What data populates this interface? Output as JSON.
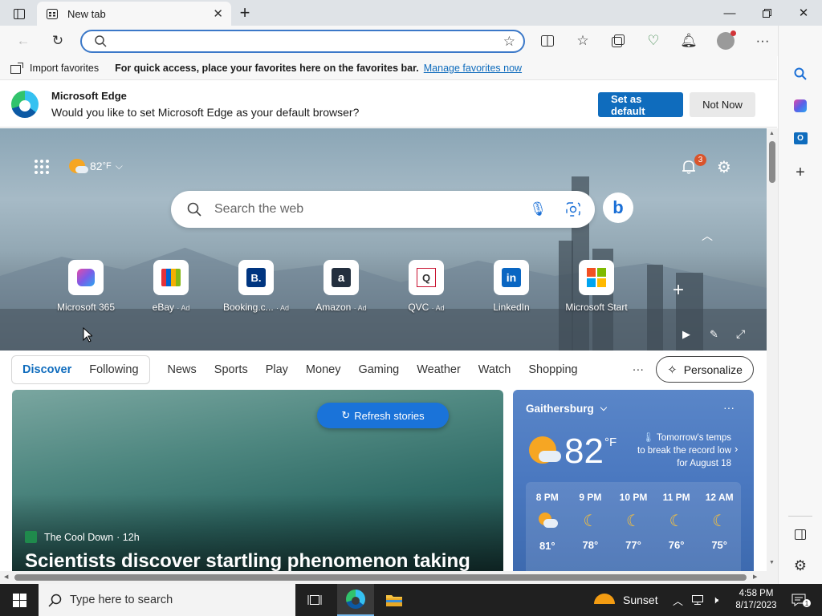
{
  "browser": {
    "tab_title": "New tab",
    "address_value": ""
  },
  "favorites_bar": {
    "import_label": "Import favorites",
    "message": "For quick access, place your favorites here on the favorites bar.",
    "manage_link": "Manage favorites now"
  },
  "infobar": {
    "title": "Microsoft Edge",
    "message": "Would you like to set Microsoft Edge as your default browser?",
    "primary_label": "Set as default",
    "secondary_label": "Not Now"
  },
  "newtab": {
    "weather_temp": "82",
    "weather_unit": "°F",
    "notification_count": "3",
    "search_placeholder": "Search the web",
    "quick_links": [
      {
        "label": "Microsoft 365",
        "ad": ""
      },
      {
        "label": "eBay",
        "ad": "· Ad"
      },
      {
        "label": "Booking.c...",
        "ad": "· Ad"
      },
      {
        "label": "Amazon",
        "ad": "· Ad"
      },
      {
        "label": "QVC",
        "ad": "· Ad"
      },
      {
        "label": "LinkedIn",
        "ad": ""
      },
      {
        "label": "Microsoft Start",
        "ad": ""
      }
    ]
  },
  "feed": {
    "tabs": [
      "Discover",
      "Following"
    ],
    "categories": [
      "News",
      "Sports",
      "Play",
      "Money",
      "Gaming",
      "Weather",
      "Watch",
      "Shopping"
    ],
    "more": "···",
    "personalize": "Personalize",
    "refresh": "Refresh stories",
    "story": {
      "source": "The Cool Down",
      "age": "· 12h",
      "headline": "Scientists discover startling phenomenon taking"
    }
  },
  "weather": {
    "city": "Gaithersburg",
    "temp": "82",
    "unit": "°F",
    "alert_line1": "Tomorrow's temps",
    "alert_line2": "to break the record low",
    "alert_line3": "for August 18",
    "hourly": [
      {
        "time": "8 PM",
        "temp": "81°",
        "icon": "partly-cloudy"
      },
      {
        "time": "9 PM",
        "temp": "78°",
        "icon": "moon"
      },
      {
        "time": "10 PM",
        "temp": "77°",
        "icon": "moon"
      },
      {
        "time": "11 PM",
        "temp": "76°",
        "icon": "moon"
      },
      {
        "time": "12 AM",
        "temp": "75°",
        "icon": "moon"
      }
    ]
  },
  "taskbar": {
    "search_placeholder": "Type here to search",
    "weather_label": "Sunset",
    "time": "4:58 PM",
    "date": "8/17/2023"
  },
  "colors": {
    "accent": "#0f6cbd",
    "titlebar": "#dfe3e7",
    "taskbar": "#202020"
  }
}
